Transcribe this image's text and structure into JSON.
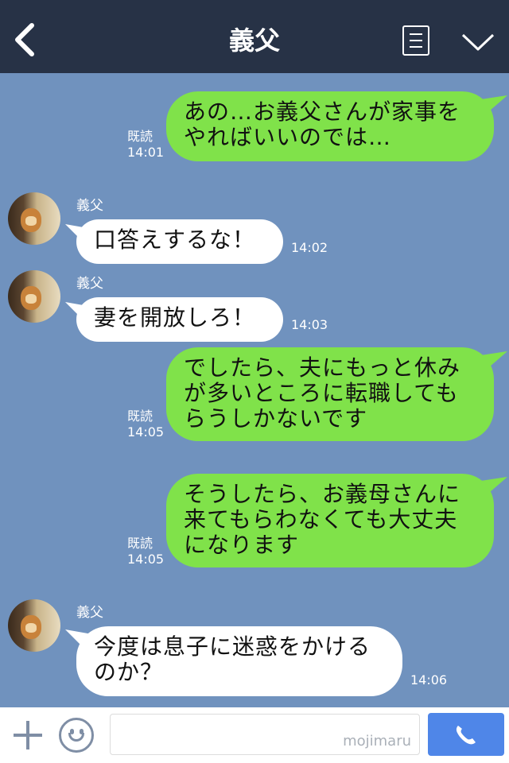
{
  "header": {
    "title": "義父"
  },
  "messages": [
    {
      "dir": "out",
      "lines": "あの…お義父さんが家事を\nやればいいのでは…",
      "read": "既読",
      "time": "14:01"
    },
    {
      "dir": "in",
      "sender": "義父",
      "lines": "口答えするな！",
      "time": "14:02"
    },
    {
      "dir": "in",
      "sender": "義父",
      "lines": "妻を開放しろ！",
      "time": "14:03"
    },
    {
      "dir": "out",
      "lines": "でしたら、夫にもっと休み\nが多いところに転職しても\nらうしかないです",
      "read": "既読",
      "time": "14:05"
    },
    {
      "dir": "out",
      "lines": "そうしたら、お義母さんに\n来てもらわなくても大丈夫\nになります",
      "read": "既読",
      "time": "14:05"
    },
    {
      "dir": "in",
      "sender": "義父",
      "lines": "今度は息子に迷惑をかける\nのか？",
      "time": "14:06"
    }
  ],
  "footer": {
    "input_placeholder": "",
    "watermark": "mojimaru"
  },
  "colors": {
    "header_bg": "#273246",
    "chat_bg": "#7092be",
    "outgoing_bubble": "#80e24a",
    "incoming_bubble": "#ffffff",
    "call_button": "#4f86e8"
  },
  "icons": {
    "back": "chevron-left-icon",
    "menu": "menu-icon",
    "collapse": "chevron-down-icon",
    "add": "plus-icon",
    "emoji": "smiley-icon",
    "call": "phone-icon"
  }
}
